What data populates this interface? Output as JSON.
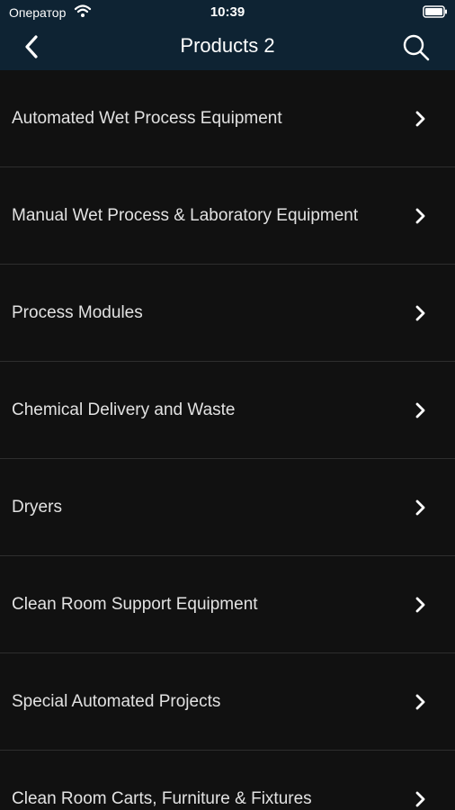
{
  "status_bar": {
    "carrier": "Оператор",
    "time": "10:39",
    "wifi_icon": "wifi-icon",
    "battery_icon": "battery-icon"
  },
  "nav": {
    "title": "Products 2",
    "back_icon": "chevron-left-icon",
    "search_icon": "search-icon"
  },
  "colors": {
    "nav_background": "#0e2333",
    "list_background": "#111111",
    "separator": "#2e2e2e",
    "text": "#e2e2e2"
  },
  "items": [
    {
      "label": "Automated Wet Process Equipment"
    },
    {
      "label": "Manual Wet Process & Laboratory Equipment"
    },
    {
      "label": "Process Modules"
    },
    {
      "label": "Chemical Delivery and Waste"
    },
    {
      "label": "Dryers"
    },
    {
      "label": "Clean Room Support Equipment"
    },
    {
      "label": "Special Automated Projects"
    },
    {
      "label": "Clean Room Carts, Furniture & Fixtures"
    }
  ]
}
